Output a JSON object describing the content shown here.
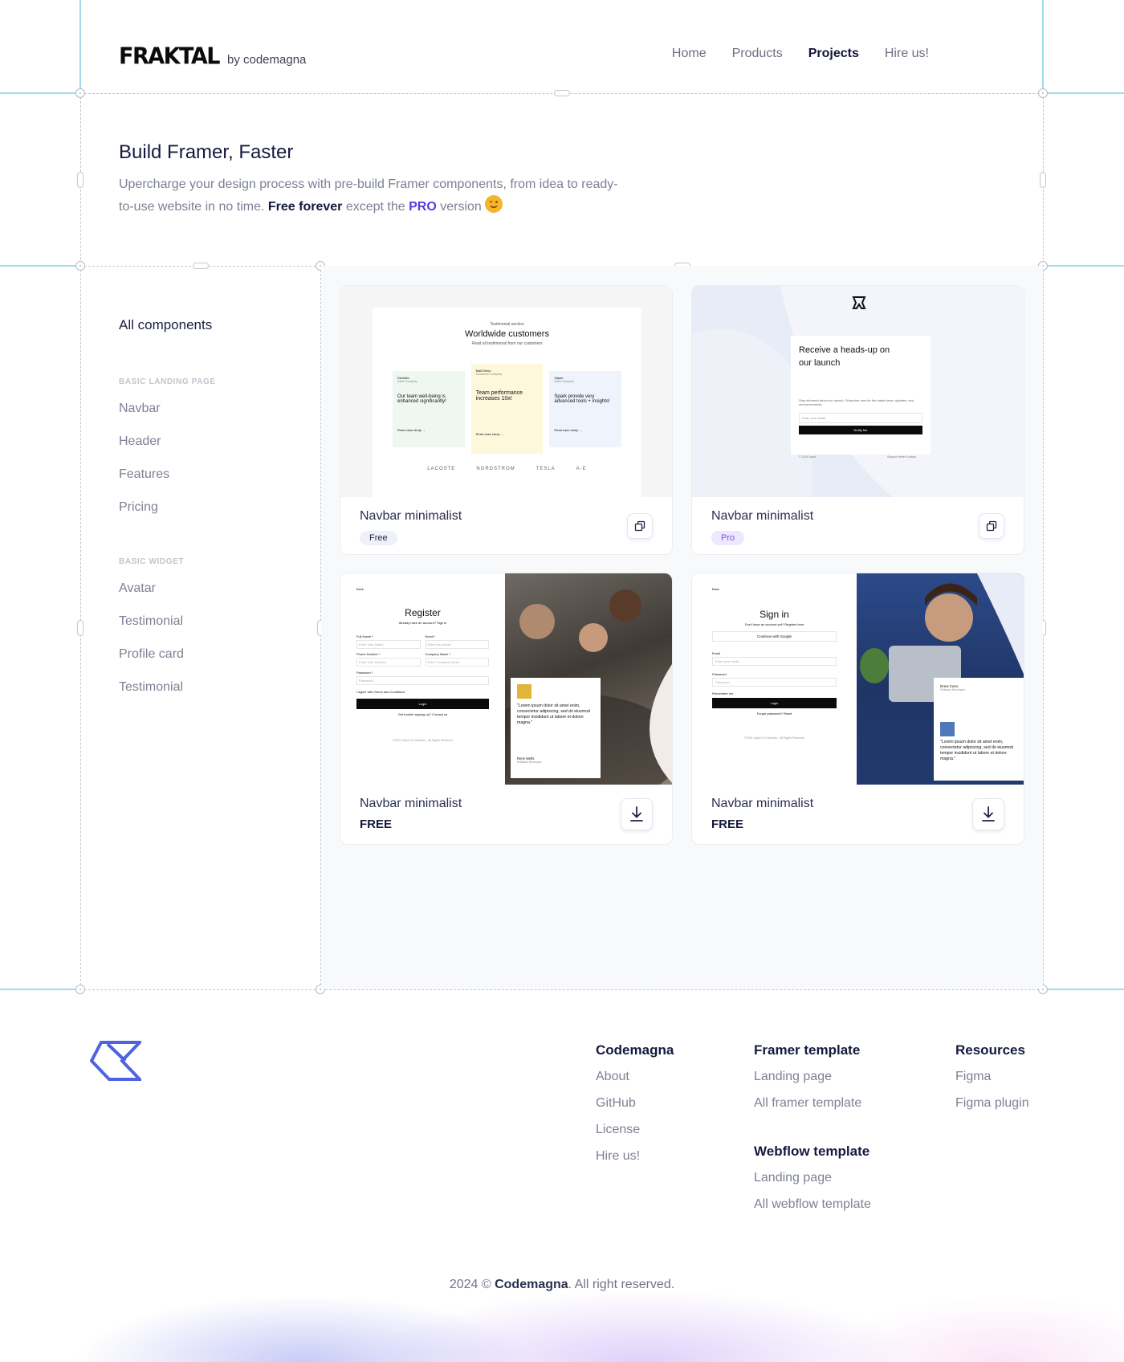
{
  "header": {
    "brand_logo": "FRAKTAL",
    "brand_by": "by codemagna",
    "nav": [
      {
        "label": "Home"
      },
      {
        "label": "Products"
      },
      {
        "label": "Projects"
      },
      {
        "label": "Hire us!"
      }
    ],
    "active_nav": "Projects"
  },
  "hero": {
    "title": "Build Framer, Faster",
    "subtitle_part1": "Upercharge your design process with pre-build Framer components, from idea to ready-to-use website in no time.",
    "subtitle_strong": "Free forever",
    "subtitle_part2": "except the",
    "subtitle_pro": "PRO",
    "subtitle_part3": "version",
    "emoji": "wink-emoji"
  },
  "sidebar": {
    "all_label": "All components",
    "sections": [
      {
        "title": "BASIC LANDING PAGE",
        "items": [
          "Navbar",
          "Header",
          "Features",
          "Pricing"
        ]
      },
      {
        "title": "BASIC WIDGET",
        "items": [
          "Avatar",
          "Testimonial",
          "Profile card",
          "Testimonial"
        ]
      }
    ]
  },
  "cards": [
    {
      "title": "Navbar minimalist",
      "badge": "Free",
      "action_icon": "copy-icon",
      "preview": {
        "kicker": "Testimonial section",
        "heading": "Worldwide customers",
        "sub": "Read all testimonial from our customers",
        "quotes": [
          {
            "company": "Dentsite",
            "role": "SaaS Company",
            "text": "Our team well-being is enhanced significantly!",
            "link": "Read case study →"
          },
          {
            "company": "MailChimp",
            "role": "Newsletter Company",
            "text": "Team performance increases 10x!",
            "link": "Read case study →"
          },
          {
            "company": "Zapier",
            "role": "SaaS Company",
            "text": "Spark provide very advanced tools + insights!",
            "link": "Read case study →"
          }
        ],
        "logos": [
          "LACOSTE",
          "NORDSTROM",
          "TESLA",
          "A-E"
        ]
      }
    },
    {
      "title": "Navbar minimalist",
      "badge": "Pro",
      "action_icon": "copy-icon",
      "preview": {
        "heading": "Receive a heads-up on our launch",
        "body": "Stay informed about our launch. Subscribe now for the latest news, updates, and announcements.",
        "placeholder": "Enter your email",
        "button": "Notify Me",
        "footer_left": "© 2024 Spark",
        "footer_right": "Support center   Contact"
      }
    },
    {
      "title": "Navbar minimalist",
      "badge_bold": "FREE",
      "action_icon": "download-icon",
      "preview": {
        "back": "Back",
        "heading": "Register",
        "sub": "Already have an account? Sign in",
        "fields": [
          "Full Name *",
          "Email *",
          "Phone Number *",
          "Company Name *",
          "Password *"
        ],
        "placeholders": [
          "Enter Your Name",
          "Enter your email",
          "Enter Your Number",
          "Enter Company Name",
          "Password"
        ],
        "agree": "I agree with Terms and Conditions",
        "button": "Login",
        "trouble": "Get trouble signing up? Contact us",
        "copyright": "©2024 Spark UI Collection - All Rights Reserved",
        "quote": "\"Lorem ipsum dolor sit amet enim, consectetur adipiscing, sed do eiusmod tempor incididunt ut labore et dolore magna.\"",
        "person": "Rene Wells",
        "person_role": "Fullstack Developer"
      }
    },
    {
      "title": "Navbar minimalist",
      "badge_bold": "FREE",
      "action_icon": "download-icon",
      "preview": {
        "back": "Back",
        "heading": "Sign in",
        "sub": "Don't have an account yet? Register here",
        "google": "Continue with Google",
        "email_label": "Email",
        "email_placeholder": "Enter your email",
        "password_label": "Password",
        "password_placeholder": "Password",
        "remember": "Remember me",
        "button": "Login",
        "forgot": "Forgot password? Reset",
        "copyright": "©2024 Spark UI Collection - All Rights Reserved",
        "person": "Drew Cano",
        "person_role": "Fullstack Developer",
        "quote": "\"Lorem ipsum dolor sit amet enim, consectetur adipiscing, sed do eiusmod tempor incididunt ut labore et dolore magna.\""
      }
    }
  ],
  "footer": {
    "logo_icon": "codemagna-logo",
    "columns": [
      {
        "title": "Codemagna",
        "links": [
          "About",
          "GitHub",
          "License",
          "Hire us!"
        ]
      },
      {
        "title": "Framer template",
        "links": [
          "Landing page",
          "All framer template"
        ]
      },
      {
        "title": "Webflow template",
        "links": [
          "Landing page",
          "All webflow template"
        ]
      },
      {
        "title": "Resources",
        "links": [
          "Figma",
          "Figma plugin"
        ]
      }
    ],
    "copyright_prefix": "2024 ©",
    "copyright_brand": "Codemagna",
    "copyright_suffix": ". All right reserved."
  },
  "colors": {
    "accent": "#5b3ddc",
    "guide": "#9fdcec",
    "logo_blue": "#4d63e0"
  }
}
